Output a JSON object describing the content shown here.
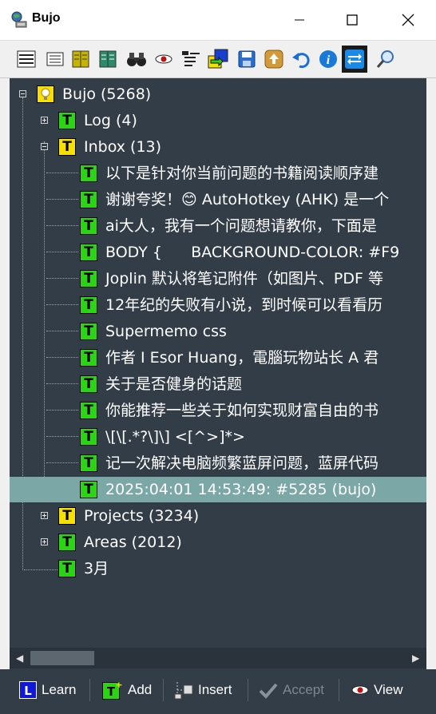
{
  "window": {
    "title": "Bujo"
  },
  "tree": {
    "root": {
      "label": "Bujo (5268)"
    },
    "nodes": [
      {
        "label": "Log (4)"
      },
      {
        "label": "Inbox (13)"
      },
      {
        "label": "Projects (3234)"
      },
      {
        "label": "Areas (2012)"
      },
      {
        "label": "3月"
      }
    ],
    "inbox_items": [
      "以下是针对你当前问题的书籍阅读顺序建",
      "谢谢夸奖！😊 AutoHotkey (AHK) 是一个",
      "ai大人，我有一个问题想请教你，下面是",
      "BODY {      BACKGROUND-COLOR: #F9",
      "Joplin 默认将笔记附件（如图片、PDF 等",
      "12年纪的失败有小说，到时候可以看看历",
      "Supermemo css",
      "作者 I Esor Huang，電腦玩物站长 A 君",
      "关于是否健身的话题",
      "你能推荐一些关于如何实现财富自由的书",
      "\\[\\[.*?\\]\\] <[^>]*>",
      "记一次解决电脑频繁蓝屏问题，蓝屏代码",
      "2025:04:01 14:53:49: #5285 (bujo)"
    ]
  },
  "bottom_buttons": {
    "learn": "Learn",
    "add": "Add",
    "insert": "Insert",
    "accept": "Accept",
    "view": "View"
  },
  "icons": {
    "node_letter": "T",
    "learn_letter": "L"
  }
}
